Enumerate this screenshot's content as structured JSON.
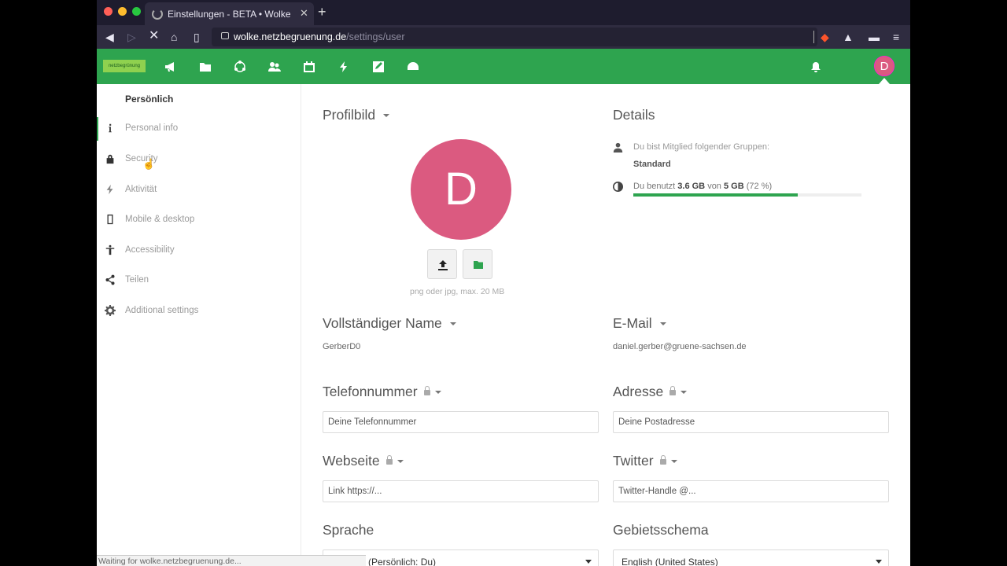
{
  "browser": {
    "tab_title": "Einstellungen - BETA • Wolke (p",
    "url_host": "wolke.netzbegruenung.de",
    "url_path": "/settings/user",
    "status": "Waiting for wolke.netzbegruenung.de..."
  },
  "header": {
    "logo_text": "netzbegrünung",
    "avatar_letter": "D",
    "apps": [
      "megaphone-icon",
      "folder-icon",
      "circles-icon",
      "contacts-icon",
      "calendar-icon",
      "activity-icon",
      "notes-icon",
      "dashboard-icon"
    ]
  },
  "sidebar": {
    "section_title": "Persönlich",
    "items": [
      {
        "label": "Personal info",
        "icon": "info-icon"
      },
      {
        "label": "Security",
        "icon": "lock-icon"
      },
      {
        "label": "Aktivität",
        "icon": "bolt-icon"
      },
      {
        "label": "Mobile & desktop",
        "icon": "phone-icon"
      },
      {
        "label": "Accessibility",
        "icon": "accessibility-icon"
      },
      {
        "label": "Teilen",
        "icon": "share-icon"
      },
      {
        "label": "Additional settings",
        "icon": "gear-icon"
      }
    ]
  },
  "profile": {
    "title": "Profilbild",
    "avatar_letter": "D",
    "hint": "png oder jpg, max. 20 MB"
  },
  "details": {
    "title": "Details",
    "groups_label": "Du bist Mitglied folgender Gruppen:",
    "group": "Standard",
    "usage_prefix": "Du benutzt",
    "usage_used": "3.6 GB",
    "usage_mid": "von",
    "usage_total": "5 GB",
    "usage_percent": "(72 %)",
    "usage_fraction": 0.72
  },
  "fields": {
    "fullname_title": "Vollständiger Name",
    "fullname_value": "GerberD0",
    "email_title": "E-Mail",
    "email_value": "daniel.gerber@gruene-sachsen.de",
    "phone_title": "Telefonnummer",
    "phone_placeholder": "Deine Telefonnummer",
    "address_title": "Adresse",
    "address_placeholder": "Deine Postadresse",
    "website_title": "Webseite",
    "website_placeholder": "Link https://...",
    "twitter_title": "Twitter",
    "twitter_placeholder": "Twitter-Handle @...",
    "language_title": "Sprache",
    "language_value": "(Persönlich: Du)",
    "locale_title": "Gebietsschema",
    "locale_value": "English (United States)"
  }
}
